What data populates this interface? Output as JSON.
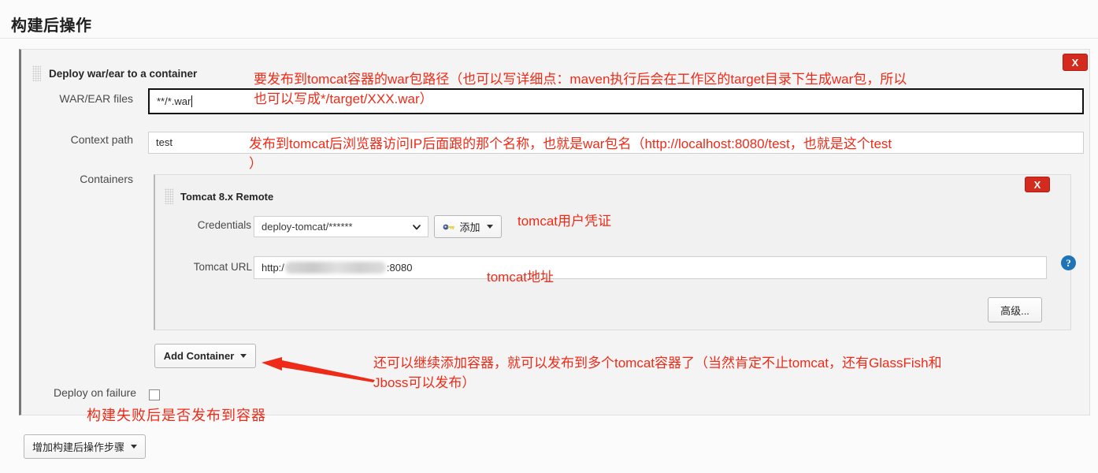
{
  "page": {
    "title": "构建后操作"
  },
  "post_build_block": {
    "title": "Deploy war/ear to a container",
    "delete_label": "X",
    "drag_handle_name": "drag-handle",
    "fields": {
      "war_files": {
        "label": "WAR/EAR files",
        "value": "**/*.war"
      },
      "context_path": {
        "label": "Context path",
        "value": "test"
      },
      "containers": {
        "label": "Containers"
      },
      "deploy_on_failure": {
        "label": "Deploy on failure",
        "checked": false
      }
    },
    "add_container_button": "Add Container"
  },
  "container_panel": {
    "title": "Tomcat 8.x Remote",
    "delete_label": "X",
    "credentials": {
      "label": "Credentials",
      "selected": "deploy-tomcat/******",
      "add_button": "添加"
    },
    "tomcat_url": {
      "label": "Tomcat URL",
      "prefix": "http:/",
      "suffix": ":8080",
      "redacted": true
    },
    "help_icon_label": "?",
    "advanced_button": "高级..."
  },
  "footer": {
    "add_step_button": "增加构建后操作步骤"
  },
  "annotations": {
    "war_files": "要发布到tomcat容器的war包路径（也可以写详细点：maven执行后会在工作区的target目录下生成war包，所以\n也可以写成*/target/XXX.war）",
    "context_path": "发布到tomcat后浏览器访问IP后面跟的那个名称，也就是war包名（http://localhost:8080/test，也就是这个test\n）",
    "credentials": "tomcat用户凭证",
    "tomcat_url": "tomcat地址",
    "add_container": "还可以继续添加容器，就可以发布到多个tomcat容器了（当然肯定不止tomcat，还有GlassFish和\nJboss可以发布）",
    "deploy_on_failure": "构建失败后是否发布到容器"
  },
  "colors": {
    "annotation_red": "#ee2b18",
    "delete_red": "#d32b1e",
    "help_blue": "#1f73b7"
  }
}
